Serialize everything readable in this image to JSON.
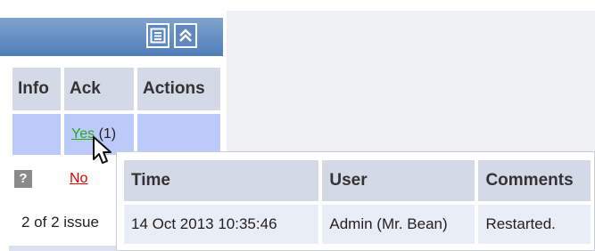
{
  "issues_panel": {
    "columns": [
      "Info",
      "Ack",
      "Actions"
    ],
    "row1": {
      "ack_label": "Yes",
      "ack_count": "(1)"
    },
    "row2": {
      "info_icon": "?",
      "ack_label": "No"
    },
    "footer_text": "2 of 2 issue"
  },
  "icons": {
    "filter": "list-icon",
    "collapse": "double-chevron-up-icon",
    "cursor": "arrow-pointer"
  },
  "ack_history": {
    "columns": [
      "Time",
      "User",
      "Comments"
    ],
    "rows": [
      {
        "time": "14 Oct 2013 10:35:46",
        "user": "Admin (Mr. Bean)",
        "comment": "Restarted."
      }
    ]
  },
  "colors": {
    "header_gradient_top": "#7fa3ce",
    "header_gradient_bottom": "#4f7fb9",
    "highlight_row": "#bccaf9",
    "yes_link": "#22aa22",
    "no_link": "#dd0000"
  }
}
